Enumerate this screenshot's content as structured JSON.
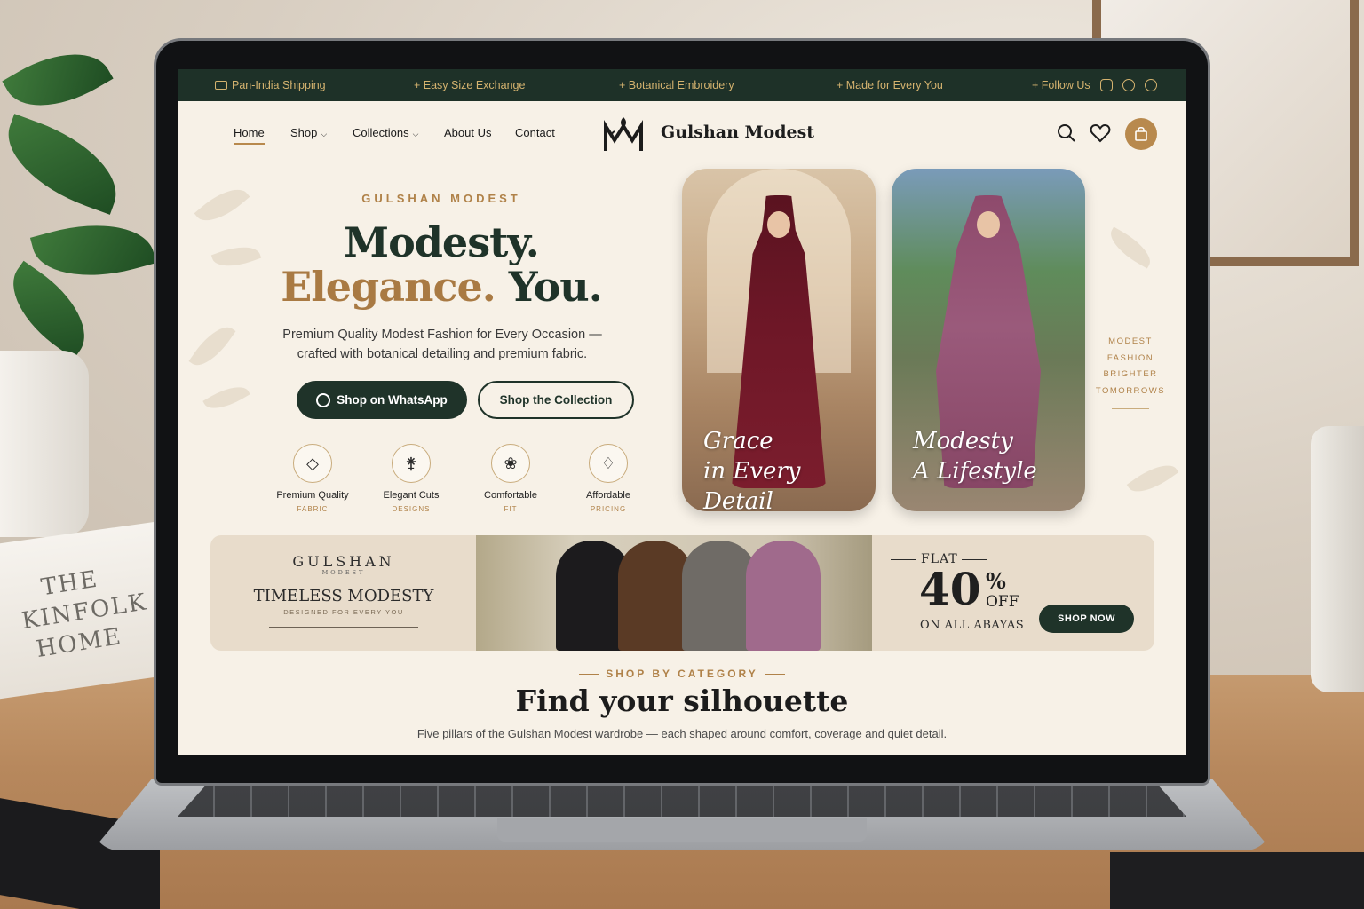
{
  "topbar": {
    "shipping": "Pan-India Shipping",
    "exchange": "+ Easy Size Exchange",
    "embroidery": "+ Botanical Embroidery",
    "made_for": "+ Made for Every You",
    "follow": "+ Follow Us",
    "social_icons": [
      "instagram-icon",
      "facebook-icon",
      "pinterest-icon"
    ]
  },
  "nav": {
    "home": "Home",
    "shop": "Shop",
    "collections": "Collections",
    "about": "About Us",
    "contact": "Contact",
    "brand": "Gulshan Modest"
  },
  "hero": {
    "eyebrow": "GULSHAN MODEST",
    "line1": "Modesty.",
    "line2_gold": "Elegance.",
    "line2_dark": "You.",
    "subtitle": "Premium Quality Modest Fashion for Every Occasion — crafted with botanical detailing and premium fabric.",
    "btn_whatsapp": "Shop on WhatsApp",
    "btn_collection": "Shop the Collection"
  },
  "features": [
    {
      "title": "Premium Quality",
      "sub": "FABRIC",
      "icon": "diamond-icon"
    },
    {
      "title": "Elegant Cuts",
      "sub": "DESIGNS",
      "icon": "dress-form-icon"
    },
    {
      "title": "Comfortable",
      "sub": "FIT",
      "icon": "leaf-icon"
    },
    {
      "title": "Affordable",
      "sub": "PRICING",
      "icon": "tag-icon"
    }
  ],
  "cards": [
    {
      "script1": "Grace",
      "script2": "in Every Detail"
    },
    {
      "script1": "Modesty",
      "script2": "A Lifestyle"
    }
  ],
  "side_tagline": [
    "MODEST",
    "FASHION",
    "BRIGHTER",
    "TOMORROWS"
  ],
  "banner": {
    "brand": "GULSHAN",
    "brand_small": "MODEST",
    "title": "TIMELESS MODESTY",
    "small": "DESIGNED FOR EVERY YOU",
    "flat": "FLAT",
    "percent": "40",
    "percent_sign": "%",
    "off": "OFF",
    "on_all": "ON ALL ABAYAS",
    "cta": "SHOP NOW",
    "abaya_colors": [
      "#1c1b1d",
      "#5a3a25",
      "#6f6b66",
      "#a06a8c"
    ]
  },
  "category": {
    "eyebrow": "SHOP BY CATEGORY",
    "title": "Find your silhouette",
    "subtitle": "Five pillars of the Gulshan Modest wardrobe — each shaped around comfort, coverage and quiet detail."
  },
  "scene": {
    "book_title": "THE KINFOLK HOME"
  },
  "colors": {
    "forest": "#1f3329",
    "gold": "#b08249",
    "cream": "#f7f1e7"
  }
}
